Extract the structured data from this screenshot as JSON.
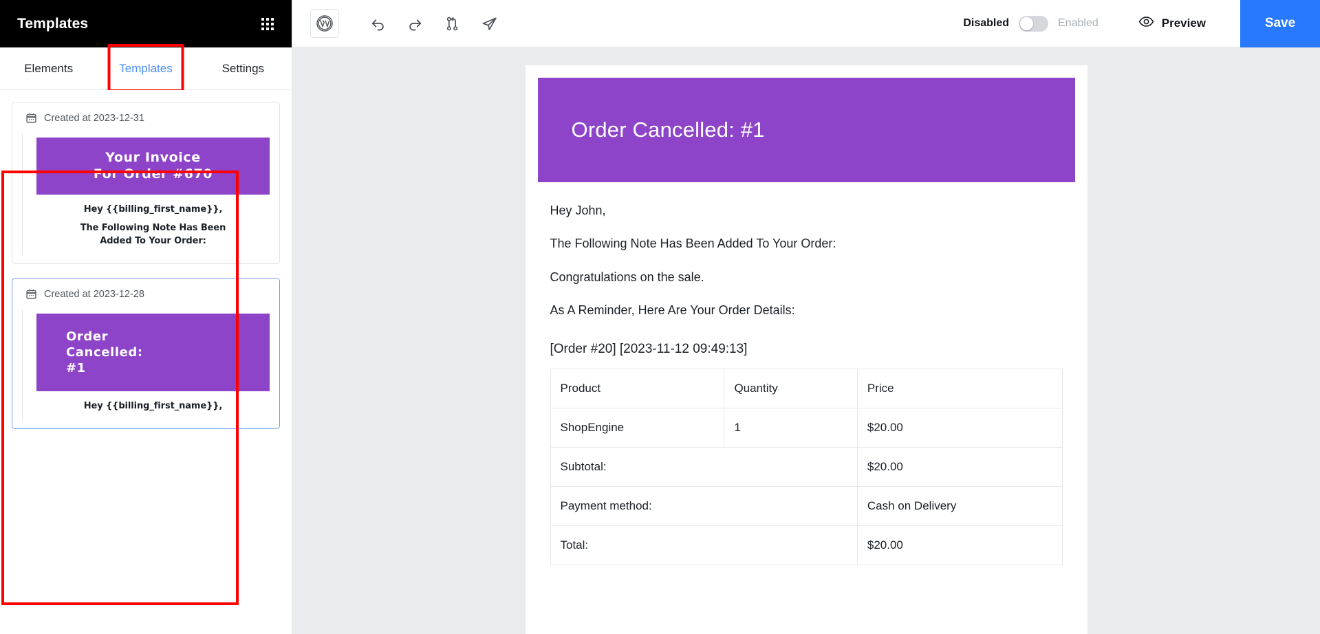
{
  "sidebar": {
    "title": "Templates",
    "grid_icon": "apps-grid-icon",
    "tabs": [
      {
        "label": "Elements",
        "active": false
      },
      {
        "label": "Templates",
        "active": true
      },
      {
        "label": "Settings",
        "active": false
      }
    ],
    "templates": [
      {
        "date_label": "Created at 2023-12-31",
        "calendar_icon": "calendar-icon",
        "banner_line1": "Your Invoice",
        "banner_line2": "For Order #670",
        "body_line1": "Hey {{billing_first_name}},",
        "body_line2a": "The Following Note Has Been",
        "body_line2b": "Added To Your Order:",
        "selected": false
      },
      {
        "date_label": "Created at 2023-12-28",
        "calendar_icon": "calendar-icon",
        "banner_line1": "Order",
        "banner_line2": "Cancelled:",
        "banner_line3": "#1",
        "body_line1": "Hey {{billing_first_name}},",
        "selected": true
      }
    ]
  },
  "toolbar": {
    "wordpress_icon": "wordpress-logo-icon",
    "undo_icon": "undo-arrow-icon",
    "redo_icon": "redo-arrow-icon",
    "revisions_icon": "revision-history-icon",
    "send_icon": "send-paper-plane-icon",
    "toggle_off_label": "Disabled",
    "toggle_on_label": "Enabled",
    "toggle_state": "off",
    "preview_icon": "eye-icon",
    "preview_label": "Preview",
    "save_label": "Save",
    "save_color": "#2979ff"
  },
  "email": {
    "banner_title": "Order Cancelled: #1",
    "banner_color": "#8e44c9",
    "paragraphs": [
      "Hey John,",
      "The Following Note Has Been Added To Your Order:",
      "Congratulations on the sale.",
      "As A Reminder, Here Are Your Order Details:"
    ],
    "order_line": "[Order #20] [2023-11-12 09:49:13]",
    "table": {
      "headers": [
        "Product",
        "Quantity",
        "Price"
      ],
      "rows": [
        {
          "cells": [
            "ShopEngine",
            "1",
            "$20.00"
          ],
          "span": false,
          "bold": false
        },
        {
          "cells": [
            "Subtotal:",
            "$20.00"
          ],
          "span": true,
          "bold": true
        },
        {
          "cells": [
            "Payment method:",
            "Cash on Delivery"
          ],
          "span": true,
          "bold": false
        },
        {
          "cells": [
            "Total:",
            "$20.00"
          ],
          "span": true,
          "bold": false
        }
      ]
    }
  },
  "annotations": {
    "highlight_color": "#ff0000"
  }
}
